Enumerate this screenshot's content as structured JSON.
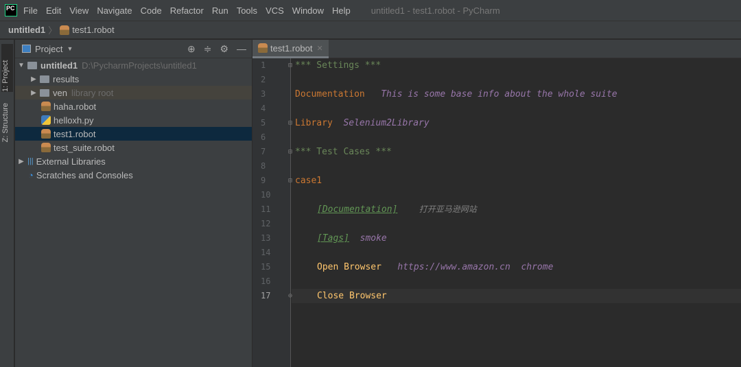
{
  "menubar": {
    "logo": "PC",
    "items": [
      "File",
      "Edit",
      "View",
      "Navigate",
      "Code",
      "Refactor",
      "Run",
      "Tools",
      "VCS",
      "Window",
      "Help"
    ],
    "window_title": "untitled1 - test1.robot - PyCharm"
  },
  "breadcrumb": {
    "project": "untitled1",
    "file": "test1.robot"
  },
  "left_strip": {
    "project": "1: Project",
    "structure": "Z: Structure"
  },
  "project_panel": {
    "title": "Project",
    "tree": {
      "root": {
        "name": "untitled1",
        "path": "D:\\PycharmProjects\\untitled1"
      },
      "items": [
        {
          "name": "results",
          "type": "folder"
        },
        {
          "name": "ven",
          "hint": "library root",
          "type": "folder"
        },
        {
          "name": "haha.robot",
          "type": "robot"
        },
        {
          "name": "helloxh.py",
          "type": "python"
        },
        {
          "name": "test1.robot",
          "type": "robot",
          "selected": true
        },
        {
          "name": "test_suite.robot",
          "type": "robot"
        }
      ],
      "external": "External Libraries",
      "scratches": "Scratches and Consoles"
    }
  },
  "editor": {
    "tab": "test1.robot",
    "current_line": 17,
    "lines": {
      "l1": "*** Settings ***",
      "l3a": "Documentation",
      "l3b": "This is some base info about the whole suite",
      "l5a": "Library",
      "l5b": "Selenium2Library",
      "l7": "*** Test Cases ***",
      "l9": "case1",
      "l11a": "[Documentation]",
      "l11b": "打开亚马逊网站",
      "l13a": "[Tags]",
      "l13b": "smoke",
      "l15a": "Open Browser",
      "l15b": "https://www.amazon.cn",
      "l15c": "chrome",
      "l17": "Close Browser"
    }
  },
  "colors": {
    "background": "#2b2b2b",
    "panel": "#3c3f41",
    "selection": "#0d293e",
    "keyword": "#cc7832",
    "argument": "#9876aa",
    "header": "#6a8759"
  }
}
